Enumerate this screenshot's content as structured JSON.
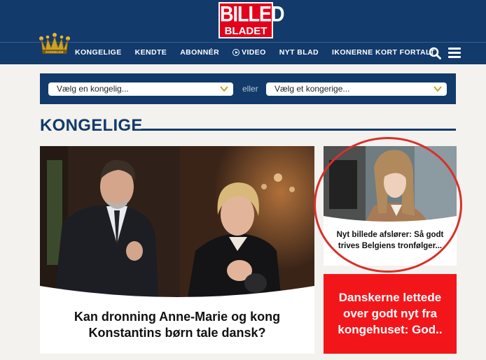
{
  "header": {
    "logo_line1": "BILLED",
    "logo_line2": "BLADET",
    "crown_text": "KONGELIGE"
  },
  "nav": {
    "items": [
      {
        "label": "KONGELIGE"
      },
      {
        "label": "KENDTE"
      },
      {
        "label": "ABONNÉR"
      },
      {
        "label": "VIDEO"
      },
      {
        "label": "NYT BLAD"
      },
      {
        "label": "IKONERNE KORT FORTALT"
      }
    ]
  },
  "filter": {
    "select_royal": "Vælg en kongelig...",
    "separator": "eller",
    "select_kingdom": "Vælg et kongerige..."
  },
  "section": {
    "title": "KONGELIGE"
  },
  "articles": {
    "main": {
      "headline": "Kan dronning Anne-Marie og kong Konstantins børn tale dansk?"
    },
    "side": {
      "headline": "Nyt billede afslører: Så godt trives Belgiens tronfølger..."
    },
    "promo": {
      "headline": "Danskerne lettede over godt nyt fra kongehuset: God.."
    }
  },
  "colors": {
    "navy": "#123a6b",
    "brand_red": "#e3001b",
    "promo_red": "#f2161b",
    "accent_gold": "#c9a227",
    "background": "#f3f2ee"
  },
  "icons": [
    "crown-icon",
    "play-icon",
    "search-icon",
    "menu-icon",
    "chevron-down-icon"
  ]
}
